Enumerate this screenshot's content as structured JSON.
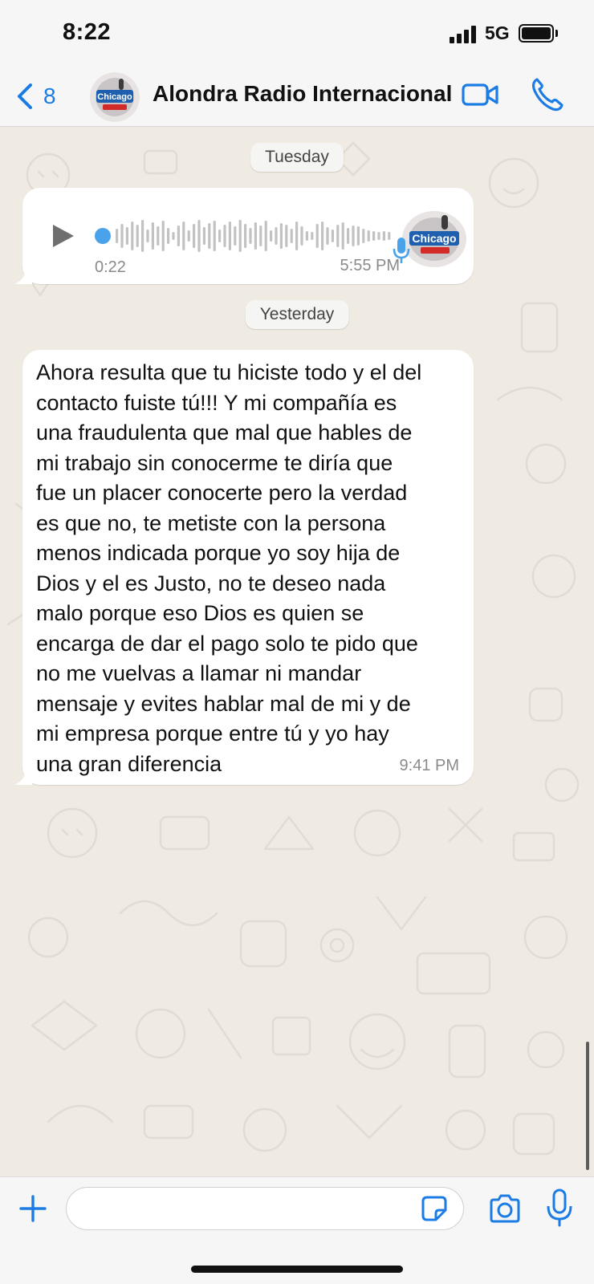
{
  "status_bar": {
    "time": "8:22",
    "network": "5G",
    "icons": [
      "signal-bars-icon",
      "battery-icon"
    ]
  },
  "header": {
    "back_count": "8",
    "contact_name": "Alondra Radio Internacional",
    "avatar_logo_text": "Chicago 112.3 FM",
    "icons": [
      "chevron-left-icon",
      "video-camera-icon",
      "phone-icon"
    ],
    "accent_color": "#1a7ce4"
  },
  "chat": {
    "background_color": "#efeae2",
    "messages": [
      {
        "date_label": "Tuesday",
        "type": "voice",
        "duration": "0:22",
        "time": "5:55 PM",
        "playback_progress": 0,
        "icons": [
          "play-icon",
          "microphone-icon"
        ]
      },
      {
        "date_label": "Yesterday",
        "type": "text",
        "text": "Ahora resulta que tu hiciste todo y el del\ncontacto fuiste tú!!! Y mi compañía es\nuna fraudulenta  que mal que hables de\nmi trabajo sin conocerme te diría que\nfue un placer conocerte pero la verdad\nes que no, te metiste con la persona\nmenos indicada porque yo soy hija de\nDios y el es Justo, no te deseo nada\nmalo porque eso Dios es quien se\nencarga de dar el pago solo te pido que\nno me vuelvas a llamar ni mandar\nmensaje y evites hablar mal de mi y de\nmi  empresa porque entre tú y yo hay\nuna gran diferencia",
        "time": "9:41 PM"
      }
    ]
  },
  "input_bar": {
    "placeholder": "",
    "icons": [
      "plus-icon",
      "sticker-icon",
      "camera-icon",
      "microphone-icon"
    ]
  }
}
